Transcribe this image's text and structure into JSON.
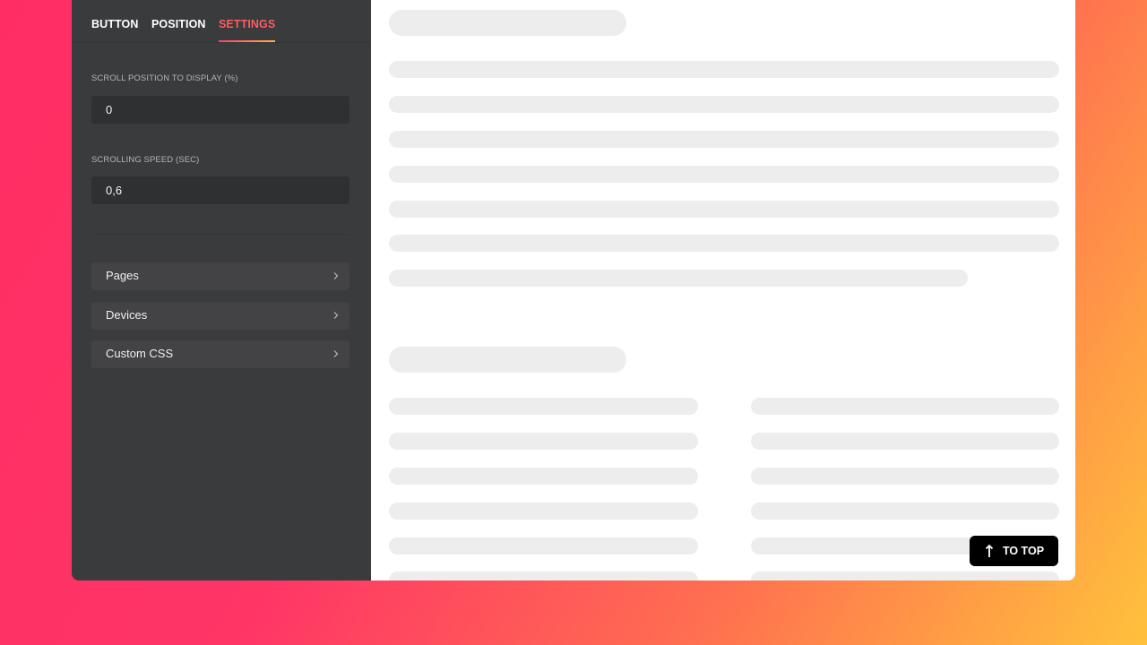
{
  "tabs": [
    {
      "label": "BUTTON",
      "active": false
    },
    {
      "label": "POSITION",
      "active": false
    },
    {
      "label": "SETTINGS",
      "active": true
    }
  ],
  "settings": {
    "scroll_position": {
      "label": "SCROLL POSITION TO DISPLAY (%)",
      "value": "0"
    },
    "scrolling_speed": {
      "label": "SCROLLING SPEED (SEC)",
      "value": "0,6"
    }
  },
  "menu": [
    {
      "label": "Pages",
      "icon": "chevron-right-icon"
    },
    {
      "label": "Devices",
      "icon": "chevron-right-icon"
    },
    {
      "label": "Custom CSS",
      "icon": "chevron-right-icon"
    }
  ],
  "to_top_button": {
    "label": "TO TOP",
    "icon": "arrow-up-icon"
  },
  "colors": {
    "accent": "#ff5a5f",
    "sidebar_bg": "#3a3b3d",
    "input_bg": "#2f3032",
    "menu_item_bg": "#434345",
    "skeleton": "#ededed",
    "button_bg": "#000000"
  }
}
